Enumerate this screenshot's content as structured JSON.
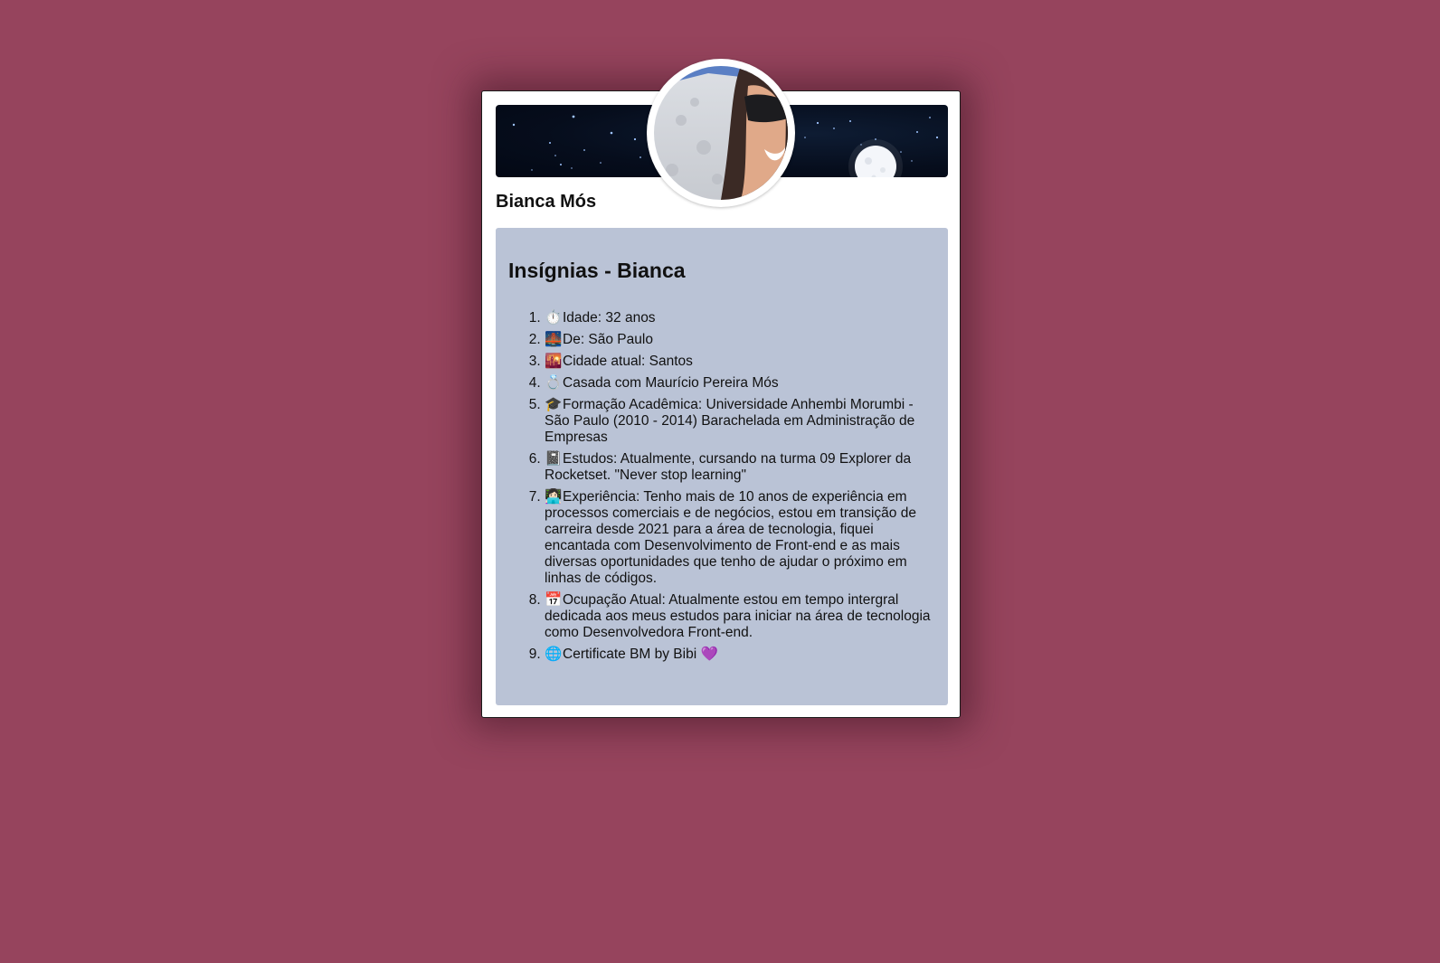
{
  "profile": {
    "name": "Bianca Mós"
  },
  "badges": {
    "title": "Insígnias - Bianca",
    "items": [
      {
        "icon": "⏱️",
        "text": "Idade: 32 anos"
      },
      {
        "icon": "🌉",
        "text": "De: São Paulo"
      },
      {
        "icon": "🌇",
        "text": "Cidade atual: Santos"
      },
      {
        "icon": "💍",
        "text": "Casada com Maurício Pereira Mós"
      },
      {
        "icon": "🎓",
        "text": "Formação Acadêmica: Universidade Anhembi Morumbi - São Paulo (2010 - 2014) Barachelada em Administração de Empresas"
      },
      {
        "icon": "📓",
        "text": "Estudos: Atualmente, cursando na turma 09 Explorer da Rocketset. \"Never stop learning\""
      },
      {
        "icon": "👩🏻‍💻",
        "text": "Experiência: Tenho mais de 10 anos de experiência em processos comerciais e de negócios, estou em transição de carreira desde 2021 para a área de tecnologia, fiquei encantada com Desenvolvimento de Front-end e as mais diversas oportunidades que tenho de ajudar o próximo em linhas de códigos."
      },
      {
        "icon": "📅",
        "text": "Ocupação Atual: Atualmente estou em tempo intergral dedicada aos meus estudos para iniciar na área de tecnologia como Desenvolvedora Front-end."
      },
      {
        "icon": "🌐",
        "text": "Certificate BM by Bibi 💜"
      }
    ]
  },
  "colors": {
    "page_background": "#96445d",
    "card_background": "#ffffff",
    "badges_background": "#bac3d6",
    "banner_sky": "#060d1c"
  },
  "icons": {
    "banner": "night-sky-moon-image",
    "avatar": "profile-photo"
  }
}
